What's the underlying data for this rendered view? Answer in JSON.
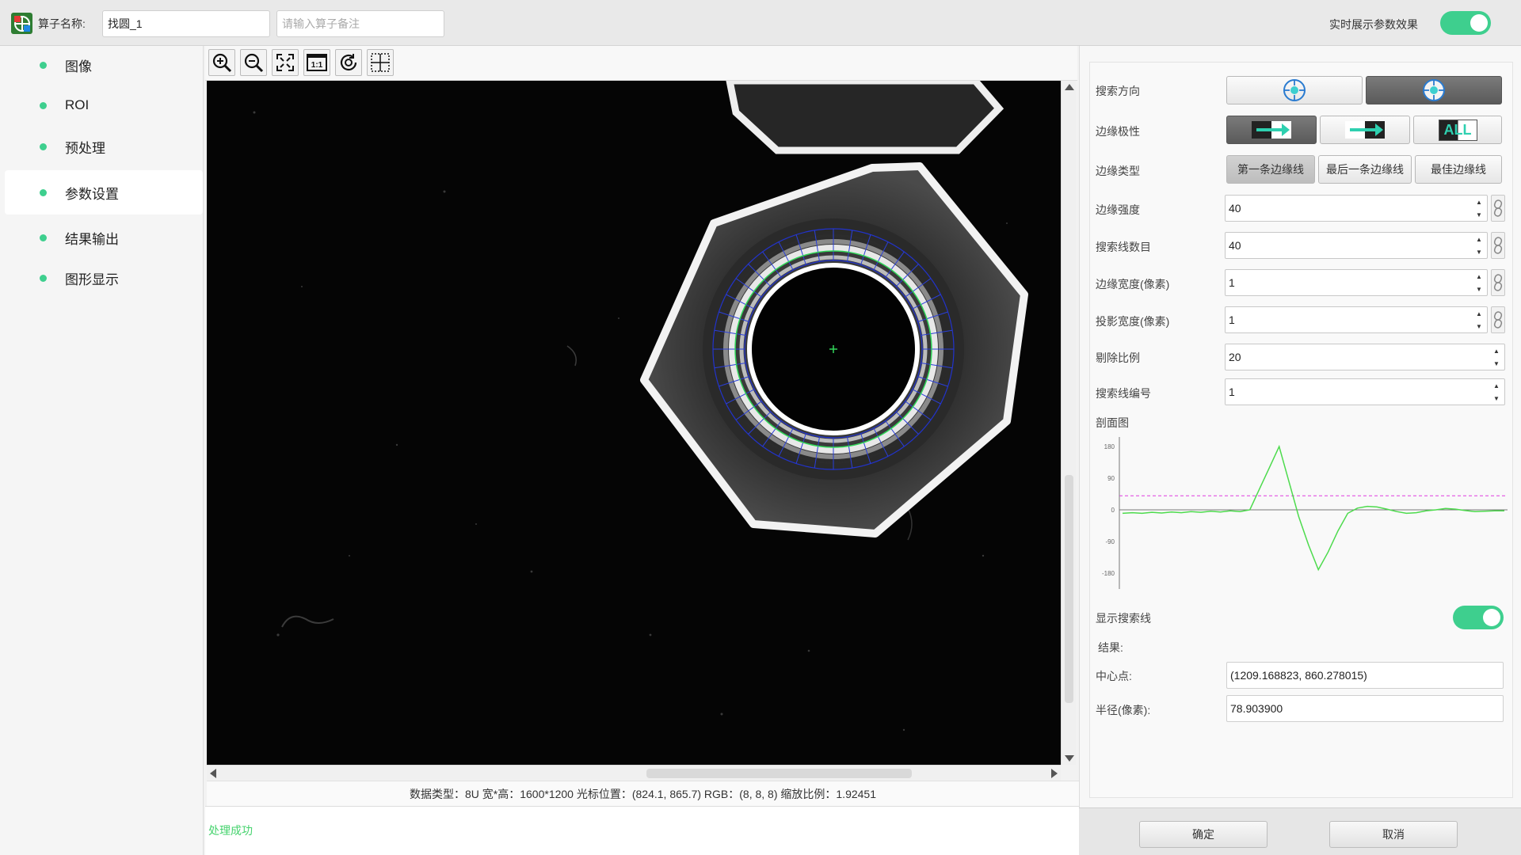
{
  "topbar": {
    "name_label": "算子名称:",
    "name_value": "找圆_1",
    "note_placeholder": "请输入算子备注",
    "realtime_label": "实时展示参数效果",
    "realtime_on": true
  },
  "sidebar": {
    "items": [
      {
        "label": "图像"
      },
      {
        "label": "ROI"
      },
      {
        "label": "预处理"
      },
      {
        "label": "参数设置",
        "active": true
      },
      {
        "label": "结果输出"
      },
      {
        "label": "图形显示"
      }
    ]
  },
  "toolbar": {
    "tools": [
      "zoom-in-icon",
      "zoom-out-icon",
      "fit-window-icon",
      "actual-size-icon",
      "rotate-icon",
      "crosshair-grid-icon"
    ],
    "actual_size_text": "1:1"
  },
  "status": {
    "info": "数据类型：8U  宽*高：1600*1200  光标位置：(824.1, 865.7)  RGB：(8, 8, 8)  缩放比例：1.92451",
    "log": "处理成功"
  },
  "params": {
    "search_direction": {
      "label": "搜索方向",
      "selected": 1
    },
    "edge_polarity": {
      "label": "边缘极性",
      "selected": 0,
      "all_text": "ALL"
    },
    "edge_type": {
      "label": "边缘类型",
      "options": [
        "第一条边缘线",
        "最后一条边缘线",
        "最佳边缘线"
      ],
      "selected": 0
    },
    "edge_strength": {
      "label": "边缘强度",
      "value": "40"
    },
    "search_line_count": {
      "label": "搜索线数目",
      "value": "40"
    },
    "edge_width": {
      "label": "边缘宽度(像素)",
      "value": "1"
    },
    "projection_width": {
      "label": "投影宽度(像素)",
      "value": "1"
    },
    "reject_ratio": {
      "label": "剔除比例",
      "value": "20"
    },
    "search_line_index": {
      "label": "搜索线编号",
      "value": "1"
    },
    "profile_label": "剖面图",
    "show_search_lines": {
      "label": "显示搜索线",
      "on": true
    }
  },
  "result": {
    "title": "结果:",
    "center_label": "中心点:",
    "center_value": "(1209.168823, 860.278015)",
    "radius_label": "半径(像素):",
    "radius_value": "78.903900"
  },
  "buttons": {
    "ok": "确定",
    "cancel": "取消"
  },
  "chart_data": {
    "type": "line",
    "title": "",
    "xlabel": "",
    "ylabel": "",
    "yticks": [
      "180",
      "90",
      "0",
      "-90",
      "-180"
    ],
    "ylim": [
      -180,
      180
    ],
    "threshold": 40,
    "series": [
      {
        "color": "#4ddb4d",
        "values": [
          -10,
          -8,
          -10,
          -7,
          -9,
          -6,
          -8,
          -5,
          -7,
          -4,
          -6,
          -3,
          -5,
          0,
          60,
          120,
          180,
          80,
          -20,
          -100,
          -170,
          -120,
          -60,
          -10,
          5,
          10,
          8,
          2,
          -5,
          -10,
          -8,
          -3,
          0,
          4,
          2,
          -2,
          -5,
          -4,
          -3,
          -3
        ]
      }
    ],
    "colors": {
      "line": "#4ddb4d",
      "threshold": "#e03ae0",
      "zero": "#777777"
    }
  }
}
